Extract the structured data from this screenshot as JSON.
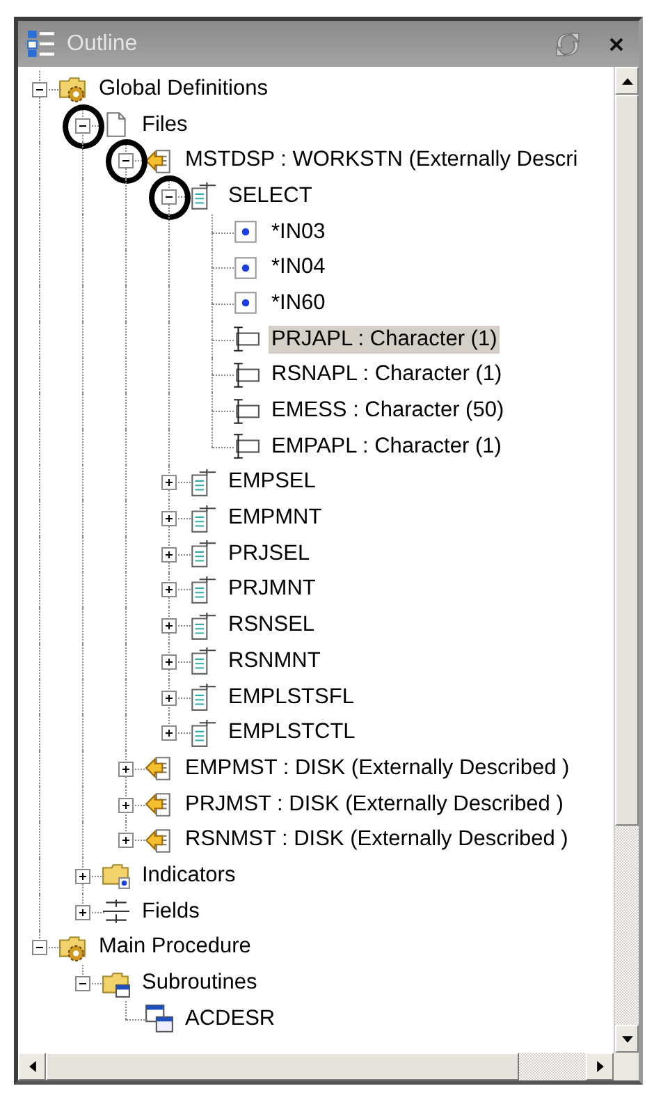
{
  "panel": {
    "title": "Outline"
  },
  "tree": [
    {
      "label": "Global Definitions",
      "kind": "folder-gear",
      "expanded": true,
      "selected": false,
      "children": [
        {
          "label": "Files",
          "kind": "file",
          "expanded": true,
          "selected": false,
          "circled": true,
          "children": [
            {
              "label": "MSTDSP : WORKSTN (Externally Descri",
              "kind": "external-file",
              "expanded": true,
              "selected": false,
              "circled": true,
              "children": [
                {
                  "label": "SELECT",
                  "kind": "record",
                  "expanded": true,
                  "selected": false,
                  "circled": true,
                  "children": [
                    {
                      "label": "*IN03",
                      "kind": "indicator",
                      "selected": false,
                      "circled": false
                    },
                    {
                      "label": "*IN04",
                      "kind": "indicator",
                      "selected": false,
                      "circled": false
                    },
                    {
                      "label": "*IN60",
                      "kind": "indicator",
                      "selected": false,
                      "circled": false
                    },
                    {
                      "label": "PRJAPL : Character (1)",
                      "kind": "field",
                      "selected": true,
                      "circled": false
                    },
                    {
                      "label": "RSNAPL : Character (1)",
                      "kind": "field",
                      "selected": false,
                      "circled": false
                    },
                    {
                      "label": "EMESS : Character (50)",
                      "kind": "field",
                      "selected": false,
                      "circled": false
                    },
                    {
                      "label": "EMPAPL : Character (1)",
                      "kind": "field",
                      "selected": false,
                      "circled": false
                    }
                  ]
                },
                {
                  "label": "EMPSEL",
                  "kind": "record",
                  "expanded": false,
                  "selected": false,
                  "circled": false
                },
                {
                  "label": "EMPMNT",
                  "kind": "record",
                  "expanded": false,
                  "selected": false,
                  "circled": false
                },
                {
                  "label": "PRJSEL",
                  "kind": "record",
                  "expanded": false,
                  "selected": false,
                  "circled": false
                },
                {
                  "label": "PRJMNT",
                  "kind": "record",
                  "expanded": false,
                  "selected": false,
                  "circled": false
                },
                {
                  "label": "RSNSEL",
                  "kind": "record",
                  "expanded": false,
                  "selected": false,
                  "circled": false
                },
                {
                  "label": "RSNMNT",
                  "kind": "record",
                  "expanded": false,
                  "selected": false,
                  "circled": false
                },
                {
                  "label": "EMPLSTSFL",
                  "kind": "record",
                  "expanded": false,
                  "selected": false,
                  "circled": false
                },
                {
                  "label": "EMPLSTCTL",
                  "kind": "record",
                  "expanded": false,
                  "selected": false,
                  "circled": false
                }
              ]
            },
            {
              "label": "EMPMST : DISK (Externally Described )",
              "kind": "external-file",
              "expanded": false,
              "selected": false,
              "circled": false
            },
            {
              "label": "PRJMST : DISK (Externally Described )",
              "kind": "external-file",
              "expanded": false,
              "selected": false,
              "circled": false
            },
            {
              "label": "RSNMST : DISK (Externally Described )",
              "kind": "external-file",
              "expanded": false,
              "selected": false,
              "circled": false
            }
          ]
        },
        {
          "label": "Indicators",
          "kind": "folder-indicator",
          "expanded": false,
          "selected": false,
          "circled": false
        },
        {
          "label": "Fields",
          "kind": "fields",
          "expanded": false,
          "selected": false,
          "circled": false
        }
      ]
    },
    {
      "label": "Main Procedure",
      "kind": "folder-gear",
      "expanded": true,
      "selected": false,
      "children": [
        {
          "label": "Subroutines",
          "kind": "folder-subroutine",
          "expanded": true,
          "selected": false,
          "children": [
            {
              "label": "ACDESR",
              "kind": "subroutine",
              "selected": false,
              "circled": false
            }
          ]
        }
      ]
    }
  ]
}
